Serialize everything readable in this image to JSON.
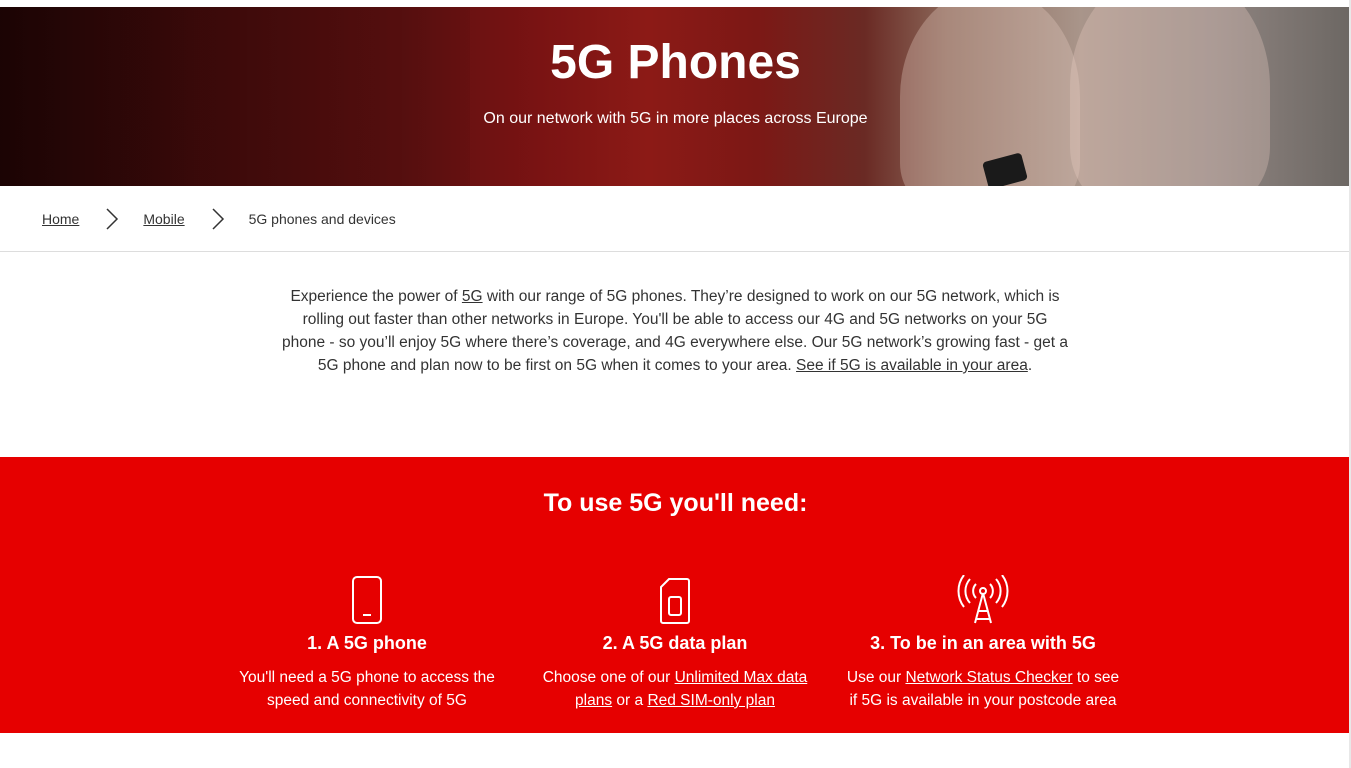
{
  "hero": {
    "title": "5G Phones",
    "subtitle": "On our network with 5G in more places across Europe"
  },
  "breadcrumb": {
    "items": [
      {
        "label": "Home"
      },
      {
        "label": "Mobile"
      }
    ],
    "current": "5G phones and devices"
  },
  "intro": {
    "part1": "Experience the power of ",
    "link1": "5G",
    "part2": " with our range of 5G phones. They’re designed to work on  our  5G network, which is rolling out faster than other networks in Europe. You'll be able to  access our 4G and 5G networks on your 5G phone  -  so you’ll enjoy 5G where there’s coverage, and 4G everywhere else. Our 5G network’s growing fast -  get a 5G phone and plan now to be first on 5G when it comes to your area. ",
    "link2": "See if 5G is available in your area",
    "part3": "."
  },
  "requirements": {
    "title": "To use 5G you'll need:",
    "steps": [
      {
        "icon": "smartphone-icon",
        "title": "1. A 5G phone",
        "text": "You'll need a 5G phone to access the speed and connectivity of 5G"
      },
      {
        "icon": "sim-card-icon",
        "title": "2. A 5G data plan",
        "text_a": "Choose one of our ",
        "link_a": "Unlimited Max data plans",
        "text_b": " or a ",
        "link_b": "Red SIM-only plan"
      },
      {
        "icon": "signal-tower-icon",
        "title": "3. To be in an area with 5G",
        "text_a": "Use our ",
        "link_a": "Network Status Checker",
        "text_b": " to see if 5G is available in your postcode area"
      }
    ]
  },
  "colors": {
    "brand_red": "#e60000",
    "text": "#333333"
  }
}
